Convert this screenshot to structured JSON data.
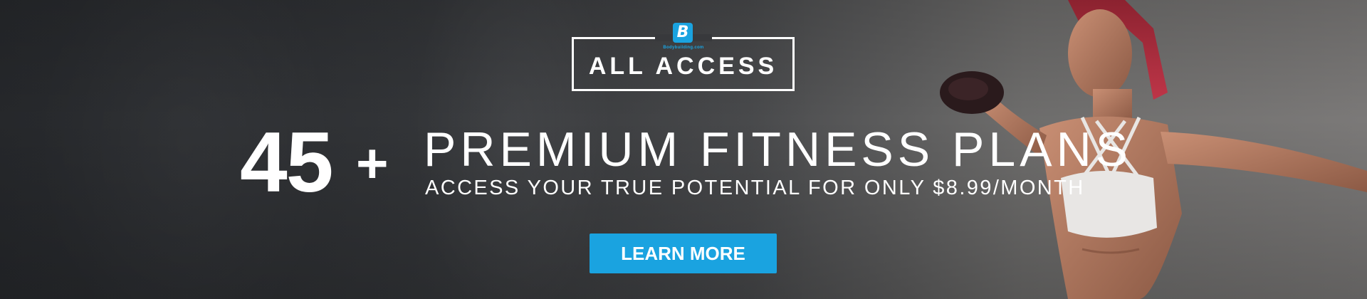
{
  "brand": {
    "badge_letter": "B",
    "badge_word": "Bodybuilding.com",
    "logo_text": "ALL ACCESS",
    "accent_color": "#1aa3e0"
  },
  "hero": {
    "count": "45",
    "count_suffix": "+",
    "headline": "PREMIUM FITNESS PLANS",
    "subline": "ACCESS YOUR TRUE POTENTIAL FOR ONLY $8.99/MONTH"
  },
  "cta": {
    "label": "LEARN MORE"
  },
  "image": {
    "subject": "athlete-photo"
  }
}
